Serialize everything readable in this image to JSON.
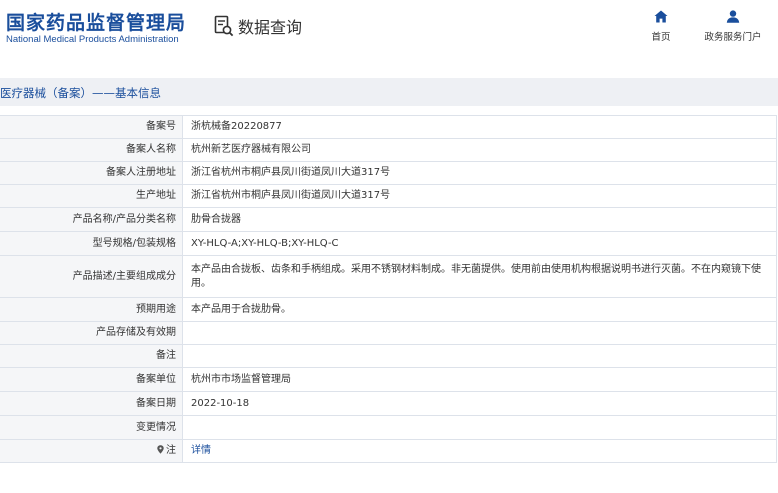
{
  "header": {
    "logo_cn": "国家药品监督管理局",
    "logo_en": "National Medical Products Administration",
    "query_label": "数据查询",
    "nav": [
      {
        "label": "首页",
        "icon": "home-icon"
      },
      {
        "label": "政务服务门户",
        "icon": "user-icon"
      }
    ]
  },
  "section": {
    "title": "医疗器械（备案）——基本信息"
  },
  "rows": [
    {
      "label": "备案号",
      "value": "浙杭械备20220877"
    },
    {
      "label": "备案人名称",
      "value": "杭州新艺医疗器械有限公司"
    },
    {
      "label": "备案人注册地址",
      "value": "浙江省杭州市桐庐县凤川街道凤川大道317号"
    },
    {
      "label": "生产地址",
      "value": "浙江省杭州市桐庐县凤川街道凤川大道317号"
    },
    {
      "label": "产品名称/产品分类名称",
      "value": "肋骨合拢器"
    },
    {
      "label": "型号规格/包装规格",
      "value": "XY-HLQ-A;XY-HLQ-B;XY-HLQ-C"
    },
    {
      "label": "产品描述/主要组成成分",
      "value": "本产品由合拢板、齿条和手柄组成。采用不锈钢材料制成。非无菌提供。使用前由使用机构根据说明书进行灭菌。不在内窥镜下使用。"
    },
    {
      "label": "预期用途",
      "value": "本产品用于合拢肋骨。"
    },
    {
      "label": "产品存储及有效期",
      "value": ""
    },
    {
      "label": "备注",
      "value": ""
    },
    {
      "label": "备案单位",
      "value": "杭州市市场监督管理局"
    },
    {
      "label": "备案日期",
      "value": "2022-10-18"
    },
    {
      "label": "变更情况",
      "value": ""
    },
    {
      "label": "注",
      "value": "详情"
    }
  ],
  "colors": {
    "brand": "#1a4e9c",
    "label_bg": "#f5f6f8",
    "border": "#dde2ea"
  }
}
